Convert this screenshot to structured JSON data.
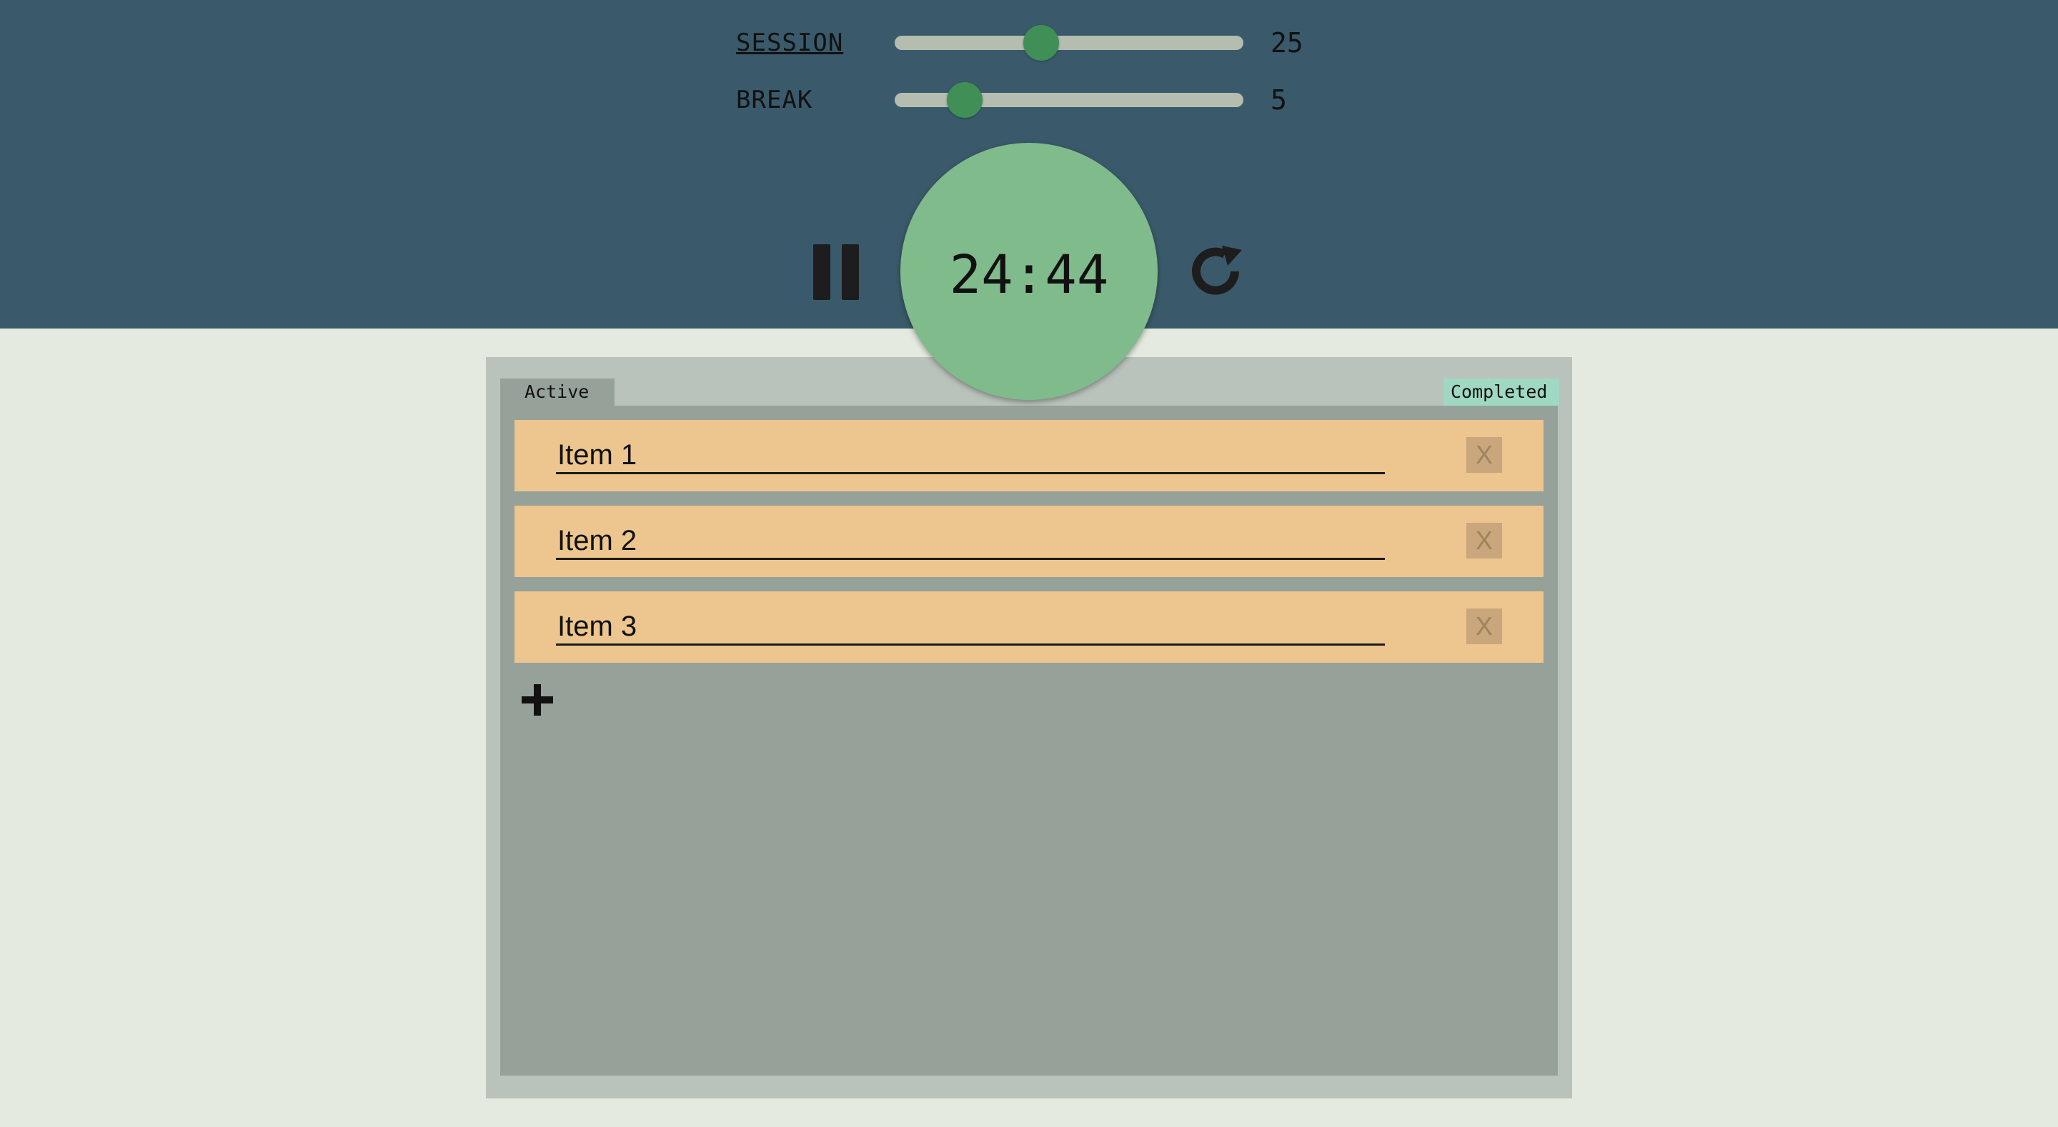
{
  "settings": {
    "session": {
      "label": "SESSION",
      "value": "25",
      "level_fraction": 0.42
    },
    "break": {
      "label": "BREAK",
      "value": "5",
      "level_fraction": 0.2
    }
  },
  "controls": {
    "pause_icon": "pause-icon",
    "reset_icon": "reset-icon"
  },
  "timer": {
    "display": "24:44"
  },
  "tabs": {
    "active_label": "Active",
    "completed_label": "Completed"
  },
  "items": [
    {
      "text": "Item 1",
      "delete_label": "X"
    },
    {
      "text": "Item 2",
      "delete_label": "X"
    },
    {
      "text": "Item 3",
      "delete_label": "X"
    }
  ],
  "add_icon": "plus-icon",
  "colors": {
    "header_bg": "#3a5a6b",
    "timer_bg": "#80bb8c",
    "slider_thumb": "#3f8f57",
    "item_bg": "#edc58e",
    "completed_tab": "#9fd8c3",
    "panel_bg": "#96a199"
  }
}
